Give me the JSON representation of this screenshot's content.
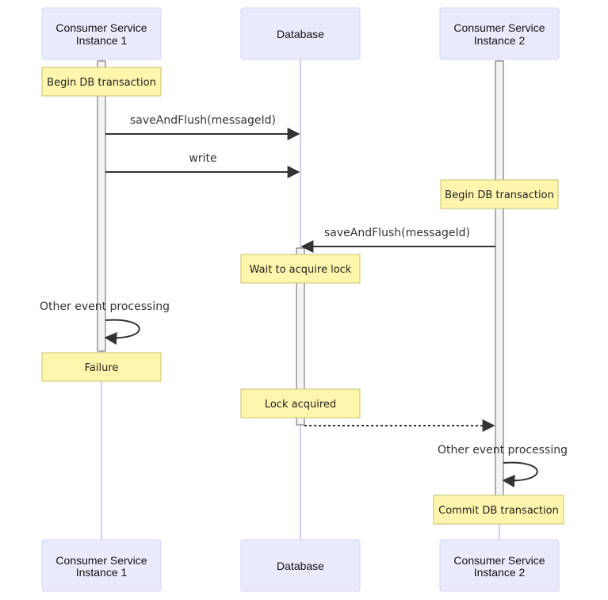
{
  "diagram": {
    "type": "sequence",
    "colors": {
      "actor_fill": "#eaeafd",
      "actor_border": "#d6d4f5",
      "lifeline": "#d3ccf7",
      "note_fill": "#fff5ad",
      "note_border": "#c8c26a",
      "activation_fill": "#f4f4f4",
      "arrow": "#333333"
    },
    "participants": [
      {
        "id": "c1",
        "label_line1": "Consumer Service",
        "label_line2": "Instance 1"
      },
      {
        "id": "db",
        "label_line1": "Database",
        "label_line2": ""
      },
      {
        "id": "c2",
        "label_line1": "Consumer Service",
        "label_line2": "Instance 2"
      }
    ],
    "notes": [
      {
        "over": "c1",
        "text": "Begin DB transaction"
      },
      {
        "over": "c2",
        "text": "Begin DB transaction"
      },
      {
        "over": "db",
        "text": "Wait to acquire lock"
      },
      {
        "over": "c1",
        "text": "Failure"
      },
      {
        "over": "db",
        "text": "Lock acquired"
      },
      {
        "over": "c2",
        "text": "Commit DB transaction"
      }
    ],
    "messages": [
      {
        "from": "c1",
        "to": "db",
        "text": "saveAndFlush(messageId)",
        "style": "solid"
      },
      {
        "from": "c1",
        "to": "db",
        "text": "write",
        "style": "solid"
      },
      {
        "from": "c2",
        "to": "db",
        "text": "saveAndFlush(messageId)",
        "style": "solid"
      },
      {
        "from": "c1",
        "to": "c1",
        "text": "Other event processing",
        "style": "self"
      },
      {
        "from": "db",
        "to": "c2",
        "text": "",
        "style": "dashed"
      },
      {
        "from": "c2",
        "to": "c2",
        "text": "Other event processing",
        "style": "self"
      }
    ]
  }
}
